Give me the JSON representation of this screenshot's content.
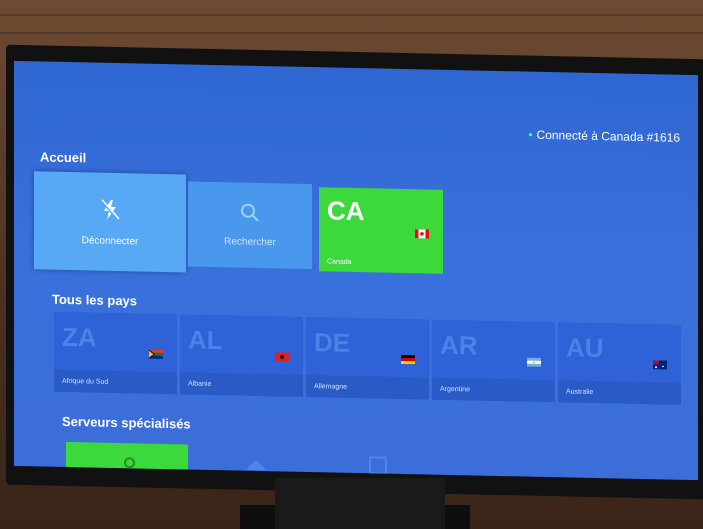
{
  "status": {
    "text": "Connecté à Canada #1616",
    "dot": "•"
  },
  "home": {
    "title": "Accueil",
    "disconnect_label": "Déconnecter",
    "search_label": "Rechercher",
    "current": {
      "code": "CA",
      "name": "Canada"
    }
  },
  "countries": {
    "title": "Tous les pays",
    "items": [
      {
        "code": "ZA",
        "name": "Afrique du Sud"
      },
      {
        "code": "AL",
        "name": "Albanie"
      },
      {
        "code": "DE",
        "name": "Allemagne"
      },
      {
        "code": "AR",
        "name": "Argentine"
      },
      {
        "code": "AU",
        "name": "Australie"
      }
    ]
  },
  "specialized": {
    "title": "Serveurs spécialisés"
  },
  "colors": {
    "screen": "#3a70dc",
    "accent_green": "#3cd93c",
    "highlight": "#57a8f5"
  }
}
